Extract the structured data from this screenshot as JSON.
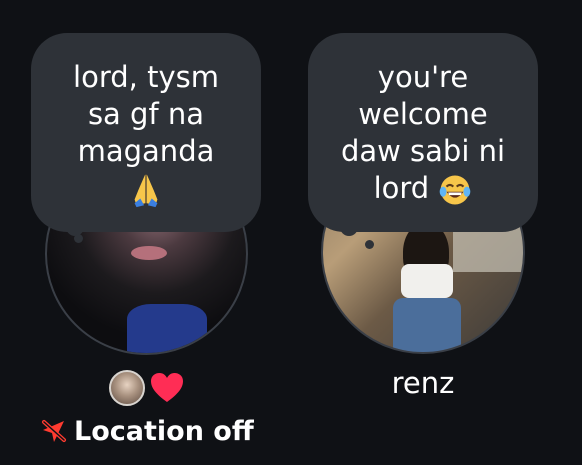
{
  "notes": {
    "left": {
      "text_lines": [
        "lord, tysm",
        "sa gf na",
        "maganda"
      ],
      "emoji": "pray-icon"
    },
    "right": {
      "text_lines": [
        "you're",
        "welcome",
        "daw sabi ni"
      ],
      "last_line": "lord",
      "emoji": "laugh-icon"
    }
  },
  "left_user": {
    "status_icons": [
      "friend-avatar",
      "heart-icon"
    ],
    "location": {
      "icon": "location-off-icon",
      "label": "Location off"
    }
  },
  "right_user": {
    "name": "renz"
  },
  "colors": {
    "background": "#0f1115",
    "bubble": "#2e3238",
    "heart": "#ff2d55",
    "location_off_icon": "#ff3b30"
  }
}
